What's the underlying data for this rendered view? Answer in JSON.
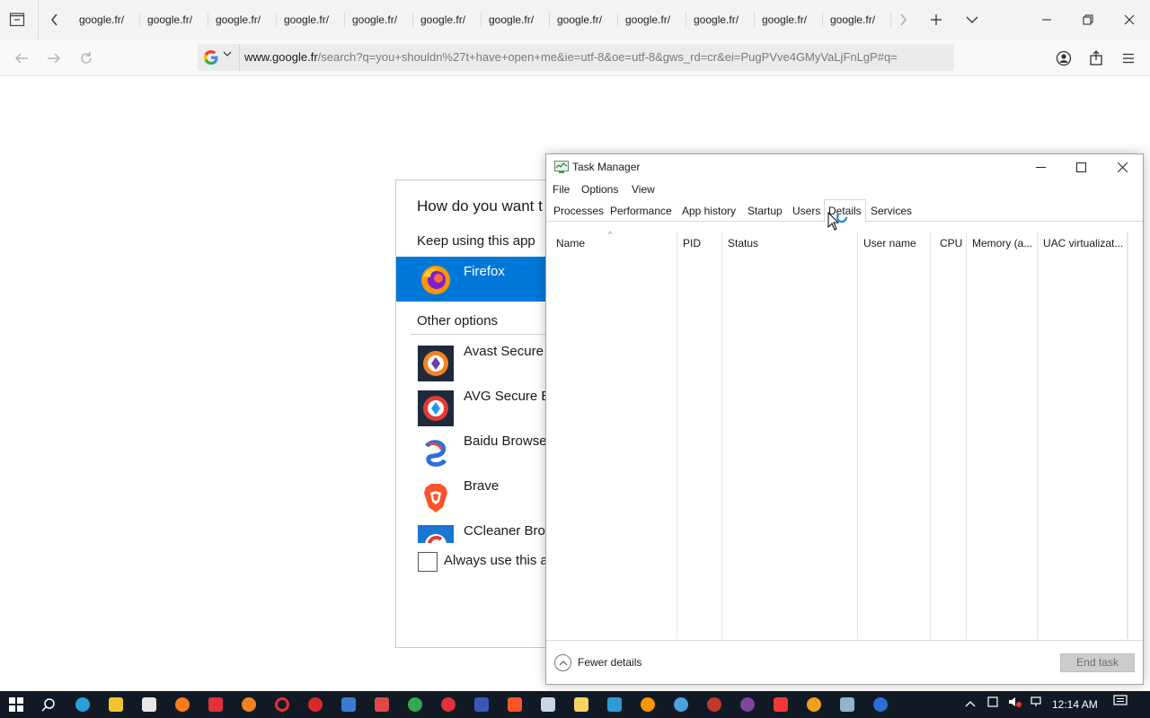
{
  "browser": {
    "tabs": [
      "google.fr/",
      "google.fr/",
      "google.fr/",
      "google.fr/",
      "google.fr/",
      "google.fr/",
      "google.fr/",
      "google.fr/",
      "google.fr/",
      "google.fr/",
      "google.fr/",
      "google.fr/"
    ],
    "url_domain": "www.google.fr",
    "url_rest": "/search?q=you+shouldn%27t+have+open+me&ie=utf-8&oe=utf-8&gws_rd=cr&ei=PugPVve4GMyVaLjFnLgP#q="
  },
  "open_with": {
    "question": "How do you want t",
    "keep_using": "Keep using this app",
    "current_app": "Firefox",
    "other_options": "Other options",
    "apps": [
      {
        "label": "Avast Secure B",
        "icon": "avast-icon"
      },
      {
        "label": "AVG Secure Br",
        "icon": "avg-icon"
      },
      {
        "label": "Baidu Browser",
        "icon": "baidu-icon"
      },
      {
        "label": "Brave",
        "icon": "brave-icon"
      },
      {
        "label": "CCleaner Brow",
        "icon": "ccleaner-icon"
      }
    ],
    "always_use": "Always use this ap"
  },
  "task_manager": {
    "title": "Task Manager",
    "menu": [
      "File",
      "Options",
      "View"
    ],
    "tabs": [
      "Processes",
      "Performance",
      "App history",
      "Startup",
      "Users",
      "Details",
      "Services"
    ],
    "active_tab": "Details",
    "columns": [
      "Name",
      "PID",
      "Status",
      "User name",
      "CPU",
      "Memory (a...",
      "UAC virtualizat..."
    ],
    "fewer_details": "Fewer details",
    "end_task": "End task"
  },
  "taskbar": {
    "time": "12:14 AM"
  },
  "colors": {
    "accent": "#0078d7",
    "taskbar": "#111a24"
  }
}
